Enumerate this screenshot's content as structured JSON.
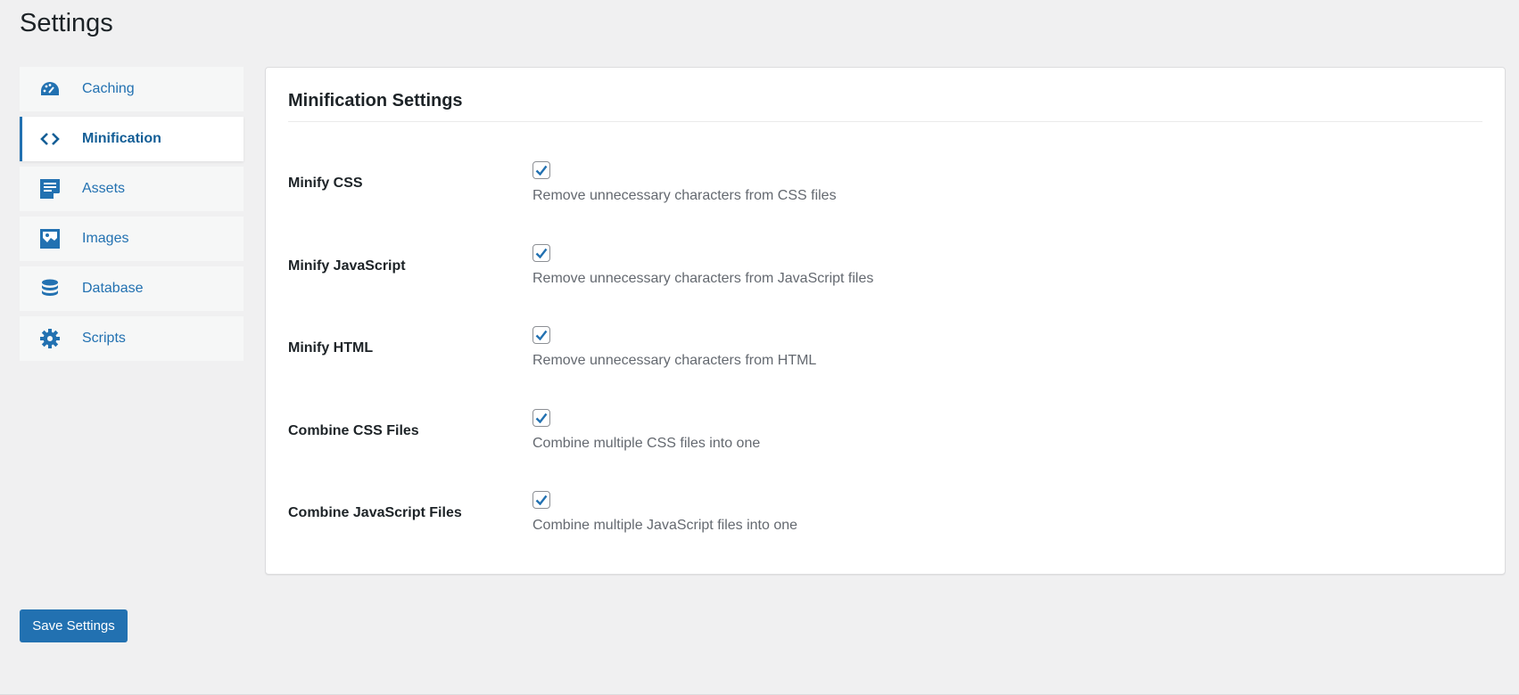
{
  "page_title": "Settings",
  "accent": "#2271b1",
  "sidebar": {
    "items": [
      {
        "label": "Caching",
        "icon": "dashboard-gauge-icon"
      },
      {
        "label": "Minification",
        "icon": "code-brackets-icon",
        "active": true
      },
      {
        "label": "Assets",
        "icon": "document-icon"
      },
      {
        "label": "Images",
        "icon": "image-icon"
      },
      {
        "label": "Database",
        "icon": "database-icon"
      },
      {
        "label": "Scripts",
        "icon": "gear-icon"
      }
    ]
  },
  "panel": {
    "title": "Minification Settings",
    "rows": [
      {
        "label": "Minify CSS",
        "checked": true,
        "description": "Remove unnecessary characters from CSS files"
      },
      {
        "label": "Minify JavaScript",
        "checked": true,
        "description": "Remove unnecessary characters from JavaScript files"
      },
      {
        "label": "Minify HTML",
        "checked": true,
        "description": "Remove unnecessary characters from HTML"
      },
      {
        "label": "Combine CSS Files",
        "checked": true,
        "description": "Combine multiple CSS files into one"
      },
      {
        "label": "Combine JavaScript Files",
        "checked": true,
        "description": "Combine multiple JavaScript files into one"
      }
    ]
  },
  "save_label": "Save Settings"
}
